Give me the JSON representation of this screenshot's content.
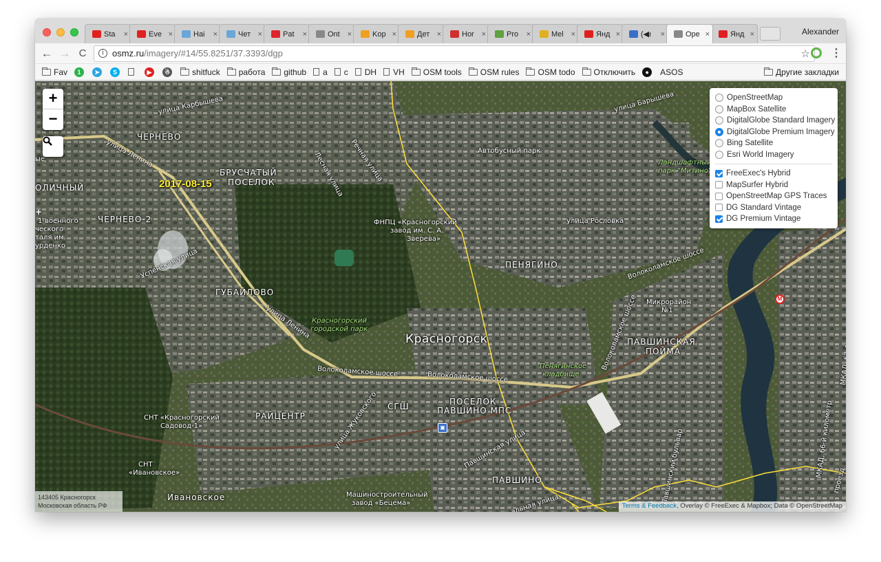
{
  "browser": {
    "tabs": [
      {
        "label": "Sta",
        "color": "#e02020",
        "icon": "youtube-icon"
      },
      {
        "label": "Eve",
        "color": "#e02020",
        "icon": "youtube-icon"
      },
      {
        "label": "Hai",
        "color": "#6aa6d8",
        "icon": "habr-icon"
      },
      {
        "label": "Чет",
        "color": "#6aa6d8",
        "icon": "habr-icon"
      },
      {
        "label": "Pat",
        "color": "#e0242b",
        "icon": "patreon-icon"
      },
      {
        "label": "Ont",
        "color": "#888888",
        "icon": "page-icon"
      },
      {
        "label": "Kop",
        "color": "#f0a020",
        "icon": "cat-icon"
      },
      {
        "label": "Дет",
        "color": "#f0a020",
        "icon": "cat-icon"
      },
      {
        "label": "Hor",
        "color": "#d03030",
        "icon": "tv-icon"
      },
      {
        "label": "Pro",
        "color": "#5fa040",
        "icon": "tool-icon"
      },
      {
        "label": "Mel",
        "color": "#e0b020",
        "icon": "battery-icon"
      },
      {
        "label": "Янд",
        "color": "#e02020",
        "icon": "map-pin-icon"
      },
      {
        "label": "(◀ı",
        "color": "#3a6fc8",
        "icon": "play-icon"
      },
      {
        "label": "Ope",
        "color": "#888888",
        "icon": "page-icon",
        "active": true
      },
      {
        "label": "Янд",
        "color": "#e02020",
        "icon": "map-pin-icon"
      }
    ],
    "close_glyph": "×",
    "profile_name": "Alexander",
    "url_host": "osmz.ru",
    "url_path": "/imagery/#14/55.8251/37.3393/dgp",
    "back": "←",
    "forward": "→",
    "reload": "C",
    "star": "☆",
    "menu": "⋮",
    "info": "i"
  },
  "bookmarks": {
    "items": [
      {
        "type": "folder",
        "label": "Fav"
      },
      {
        "type": "dot",
        "label": "1",
        "color": "#2bb24c"
      },
      {
        "type": "dot",
        "label": "➤",
        "color": "#2ca5e0"
      },
      {
        "type": "dot",
        "label": "S",
        "color": "#00aff0"
      },
      {
        "type": "page",
        "label": ""
      },
      {
        "type": "dot",
        "label": "▶",
        "color": "#e02020"
      },
      {
        "type": "dot",
        "label": "☃",
        "color": "#555555"
      },
      {
        "type": "folder",
        "label": "shitfuck"
      },
      {
        "type": "folder",
        "label": "работа"
      },
      {
        "type": "folder",
        "label": "github"
      },
      {
        "type": "page",
        "label": "a"
      },
      {
        "type": "page",
        "label": "c"
      },
      {
        "type": "page",
        "label": "DH"
      },
      {
        "type": "page",
        "label": "VH"
      },
      {
        "type": "folder",
        "label": "OSM tools"
      },
      {
        "type": "folder",
        "label": "OSM rules"
      },
      {
        "type": "folder",
        "label": "OSM todo"
      },
      {
        "type": "folder",
        "label": "Отключить"
      },
      {
        "type": "dot",
        "label": "●",
        "color": "#111111"
      },
      {
        "type": "text",
        "label": "ASOS"
      }
    ],
    "other": "Другие закладки"
  },
  "map": {
    "zoom_in": "+",
    "zoom_out": "−",
    "search": "🔍",
    "imagery_date": "2017-08-15",
    "base_layers": [
      {
        "label": "OpenStreetMap",
        "selected": false
      },
      {
        "label": "MapBox Satellite",
        "selected": false
      },
      {
        "label": "DigitalGlobe Standard Imagery",
        "selected": false
      },
      {
        "label": "DigitalGlobe Premium Imagery",
        "selected": true
      },
      {
        "label": "Bing Satellite",
        "selected": false
      },
      {
        "label": "Esri World Imagery",
        "selected": false
      }
    ],
    "overlays": [
      {
        "label": "FreeExec's Hybrid",
        "checked": true
      },
      {
        "label": "MapSurfer Hybrid",
        "checked": false
      },
      {
        "label": "OpenStreetMap GPS Traces",
        "checked": false
      },
      {
        "label": "DG Standard Vintage",
        "checked": false
      },
      {
        "label": "DG Premium Vintage",
        "checked": true
      }
    ],
    "labels": {
      "chernevo": "ЧЕРНЕВО",
      "bruschaty": "БРУСЧАТЫЙ",
      "poselok1": "ПОСЕЛОК",
      "olichny": "ОЛИЧНЫЙ",
      "chernevo2": "ЧЕРНЕВО-2",
      "gubailovo": "ГУБАЙЛОВО",
      "krasnogorsk": "Красногорск",
      "penyagino": "ПЕНЯГИНО",
      "pavshinskaya": "ПАВШИНСКАЯ",
      "poima": "ПОЙМА",
      "raicentr": "РАЙЦЕНТР",
      "sgsh": "СГШ",
      "poselok2": "ПОСЕЛОК",
      "pavshino_mps": "ПАВШИНО МПС",
      "pavshino": "ПАВШИНО",
      "ivanovskoe": "Ивановское",
      "st_karbysheva": "улица Карбышева",
      "st_lenina": "улица Ленина",
      "st_lenina2": "улица Ленина",
      "st_lesnaya": "Лесная улица",
      "st_rechnaya": "Речная улица",
      "st_barysheva": "улица Барышева",
      "st_roslovka": "улица Рословка",
      "volokolamskoe1": "Волоколамское шоссе",
      "volokolamskoe2": "Волоколамское шоссе",
      "volokolamskoe3": "Волоколамское шоссе",
      "volokolamskoe4": "Волоколамское шоссе",
      "pavshinskaya_st": "Павшинская улица",
      "avtobusny_park": "Автобусный парк",
      "fnpc1": "ФНПЦ «Красногорский",
      "fnpc2": "завод им. С. А.",
      "fnpc3": "Зверева»",
      "landscape1": "Ландшафтный",
      "landscape2": "парк \"Митино\"",
      "kr_park1": "Красногорский",
      "kr_park2": "городской парк",
      "penyag_cem1": "Пенягинское",
      "penyag_cem2": "кладбище",
      "snt1": "СНТ «Красногорский",
      "snt2": "Садовод-1»",
      "snt3": "СНТ",
      "snt4": "«Ивановское»",
      "mikroraion1": "Микрорайон",
      "mikroraion2": "№1",
      "mashzavod1": "Машиностроительный",
      "mashzavod2": "завод «Бецема»",
      "mkad1": "МКАД, 67-й километр",
      "mkad2": "МКАД, 66-й километр",
      "voen1": "1-военного",
      "voen2": "ческого",
      "voen3": "таля им.",
      "voen4": "урденко",
      "uspenskaya": "Успенская улица",
      "st_zhukovskogo": "улица Жуковского",
      "pavshinsky_bulvar": "Павшинский бульвар",
      "proezd": "проезд",
      "rossiyskaya": "альная улица",
      "st_left": "ые"
    },
    "address_line1": "143405 Красногорск",
    "address_line2": "Московская область РФ",
    "attrib_link": "Terms & Feedback",
    "attrib_text": ", Overlay © FreeExec & Mapbox; Data © OpenStreetMap",
    "metro_badge": "M",
    "rail_badge": "▣"
  }
}
